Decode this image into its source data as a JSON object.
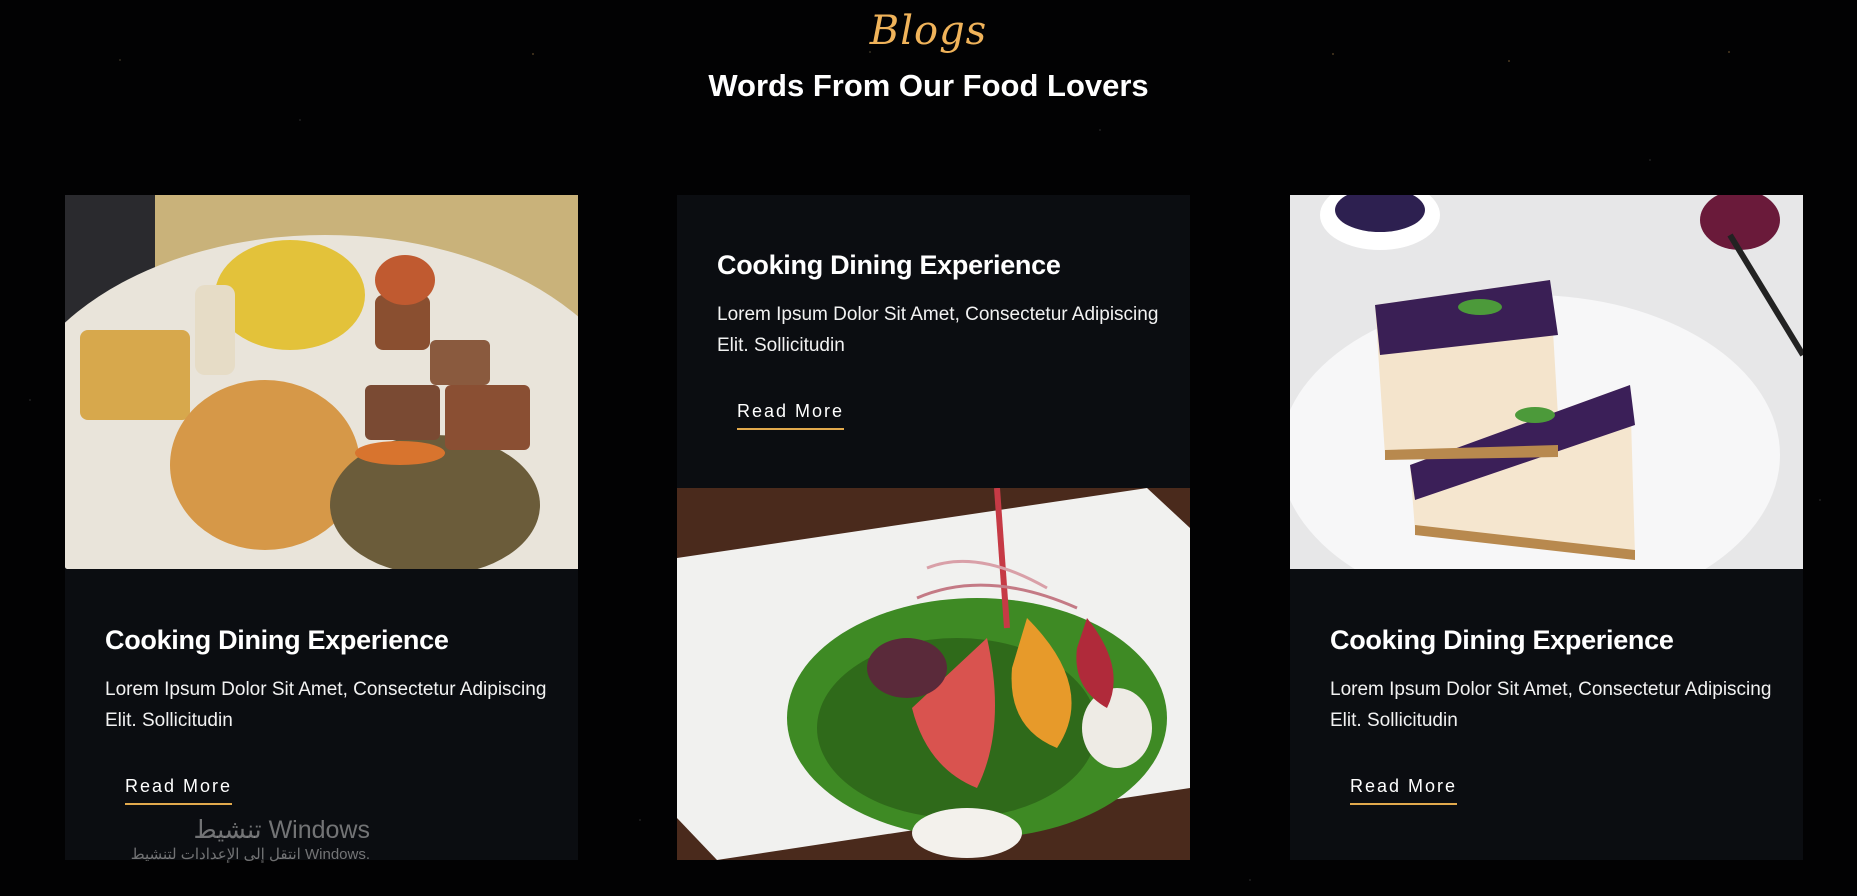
{
  "header": {
    "eyebrow": "Blogs",
    "title": "Words From Our Food Lovers"
  },
  "cards": [
    {
      "title": "Cooking Dining Experience",
      "text": "Lorem Ipsum Dolor Sit Amet, Consectetur Adipiscing Elit. Sollicitudin",
      "link": "Read More",
      "image": "plate-of-mixed-food-photo"
    },
    {
      "title": "Cooking Dining Experience",
      "text": "Lorem Ipsum Dolor Sit Amet, Consectetur Adipiscing Elit. Sollicitudin",
      "link": "Read More",
      "image": "beet-salad-photo"
    },
    {
      "title": "Cooking Dining Experience",
      "text": "Lorem Ipsum Dolor Sit Amet, Consectetur Adipiscing Elit. Sollicitudin",
      "link": "Read More",
      "image": "blueberry-cheesecake-photo"
    }
  ],
  "watermark": {
    "line1": "تنشيط Windows",
    "line2": "انتقل إلى الإعدادات لتنشيط Windows."
  },
  "colors": {
    "accent": "#f0b35a",
    "card_bg": "#0b0d11",
    "page_bg": "#020203"
  }
}
